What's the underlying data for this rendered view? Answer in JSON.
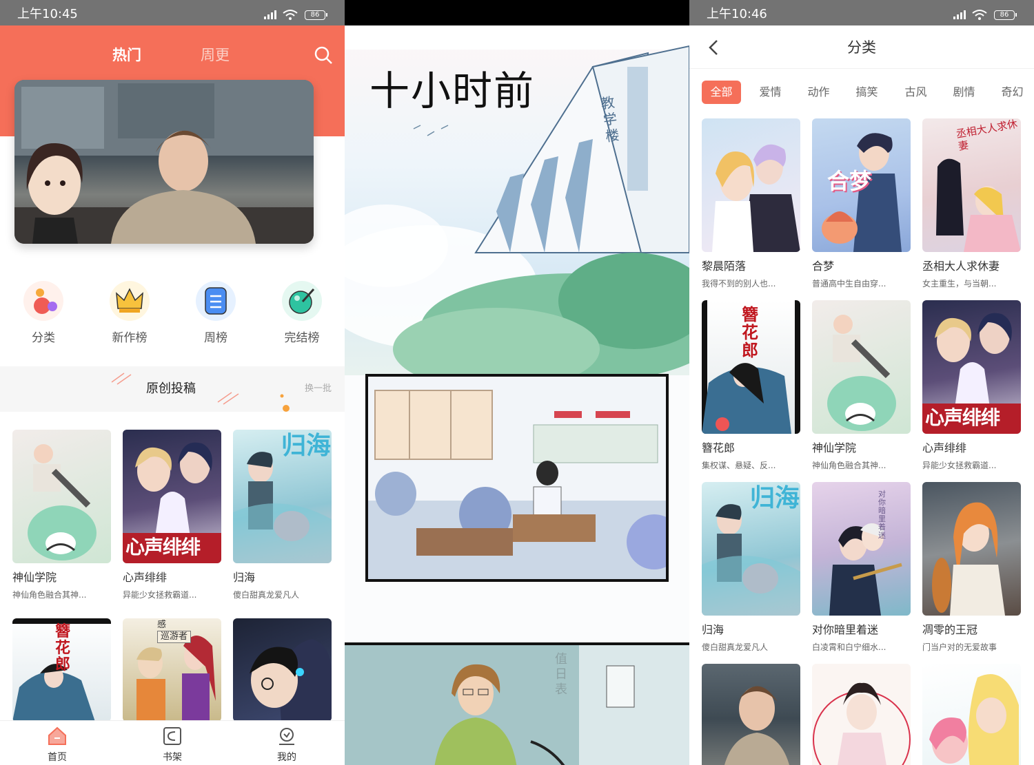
{
  "colors": {
    "accent": "#f56f59",
    "status_bar": "#737373"
  },
  "status_time_1": "上午10:45",
  "status_time_3": "上午10:46",
  "battery": "86",
  "home": {
    "tabs": [
      "热门",
      "周更"
    ],
    "categories": [
      "分类",
      "新作榜",
      "周榜",
      "完结榜"
    ],
    "section_title": "原创投稿",
    "refresh_label": "换一批",
    "comics": [
      {
        "title": "神仙学院",
        "desc": "神仙角色融合其神..."
      },
      {
        "title": "心声绯绯",
        "desc": "异能少女拯救霸道..."
      },
      {
        "title": "归海",
        "desc": "傻白甜真龙爱凡人"
      }
    ],
    "cover_texts": {
      "xinsheng": "心声绯绯",
      "guihai": "归海",
      "zanhua": "簪花郎",
      "gan": "感",
      "xunyou": "巡游者"
    },
    "bottom_nav": [
      "首页",
      "书架",
      "我的"
    ]
  },
  "reader": {
    "caption": "十小时前",
    "sign": "教学楼",
    "duty": "值日表"
  },
  "category_page": {
    "title": "分类",
    "chips": [
      "全部",
      "爱情",
      "动作",
      "搞笑",
      "古风",
      "剧情",
      "奇幻"
    ],
    "active_chip": "全部",
    "comics": [
      {
        "title": "黎晨陌落",
        "desc": "我得不到的别人也..."
      },
      {
        "title": "合梦",
        "desc": "普通高中生自由穿..."
      },
      {
        "title": "丞相大人求休妻",
        "desc": "女主重生，与当朝..."
      },
      {
        "title": "簪花郎",
        "desc": "集权谋、悬疑、反..."
      },
      {
        "title": "神仙学院",
        "desc": "神仙角色融合其神..."
      },
      {
        "title": "心声绯绯",
        "desc": "异能少女拯救霸道..."
      },
      {
        "title": "归海",
        "desc": "傻白甜真龙爱凡人"
      },
      {
        "title": "对你暗里着迷",
        "desc": "白凌霄和白宁细水..."
      },
      {
        "title": "凋零的王冠",
        "desc": "门当户对的无爱故事"
      }
    ],
    "cover_texts": {
      "hemeng": "合梦",
      "chengxiang": "丞相大人求休妻",
      "zanhua": "簪花郎",
      "xinsheng": "心声绯绯",
      "guihai": "归海",
      "duini": "对你暗里着迷"
    }
  }
}
